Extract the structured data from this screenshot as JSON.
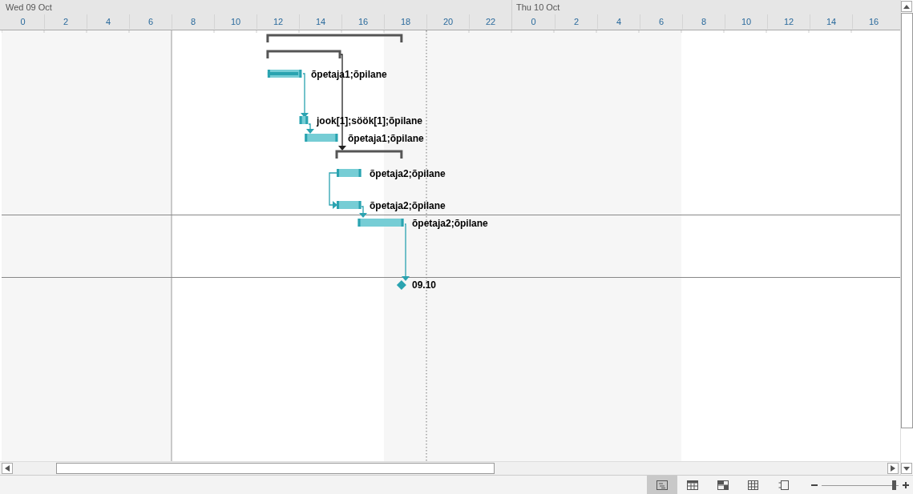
{
  "timeline": {
    "days": [
      {
        "label": "Wed 09 Oct",
        "ticks": [
          "0",
          "2",
          "4",
          "6",
          "8",
          "10",
          "12",
          "14",
          "16",
          "18",
          "20",
          "22"
        ]
      },
      {
        "label": "Thu 10 Oct",
        "ticks": [
          "0",
          "2",
          "4",
          "6",
          "8",
          "10",
          "12",
          "14",
          "16"
        ]
      }
    ]
  },
  "tasks": [
    {
      "kind": "summary"
    },
    {
      "kind": "summary"
    },
    {
      "kind": "task",
      "label": "õpetaja1;õpilane",
      "level": 0.9
    },
    {
      "kind": "task",
      "label": "jook[1];söök[1];õpilane"
    },
    {
      "kind": "task",
      "label": "õpetaja1;õpilane"
    },
    {
      "kind": "summary"
    },
    {
      "kind": "task",
      "label": "õpetaja2;õpilane"
    },
    {
      "kind": "task",
      "label": "õpetaja2;õpilane"
    },
    {
      "kind": "task",
      "label": "õpetaja2;õpilane"
    },
    {
      "kind": "milestone",
      "label": "09.10"
    }
  ],
  "status_bar": {
    "views": [
      {
        "selected": true
      },
      {
        "selected": false
      },
      {
        "selected": false
      },
      {
        "selected": false
      },
      {
        "selected": false
      }
    ],
    "zoom": {
      "level": 0.95
    }
  }
}
